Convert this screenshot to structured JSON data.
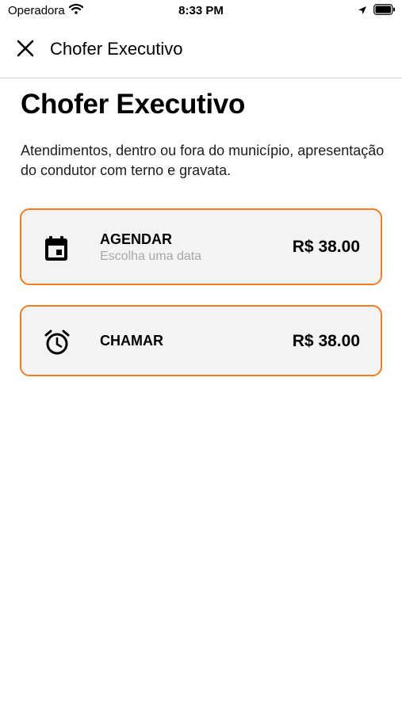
{
  "status_bar": {
    "carrier": "Operadora",
    "time": "8:33 PM",
    "icons": [
      "wifi-icon",
      "location-icon",
      "battery-icon"
    ]
  },
  "nav": {
    "close_icon": "close-icon",
    "title": "Chofer Executivo"
  },
  "page": {
    "title": "Chofer Executivo",
    "description": "Atendimentos, dentro ou fora do município, apresentação do condutor com terno e gravata."
  },
  "options": [
    {
      "icon": "calendar-icon",
      "label": "AGENDAR",
      "sublabel": "Escolha uma data",
      "price": "R$ 38.00"
    },
    {
      "icon": "alarm-clock-icon",
      "label": "CHAMAR",
      "price": "R$ 38.00"
    }
  ],
  "colors": {
    "accent_border": "#f47b20",
    "card_background": "#f3f3f3",
    "sublabel_text": "#a8a8a8",
    "divider": "#cfcfcf"
  }
}
